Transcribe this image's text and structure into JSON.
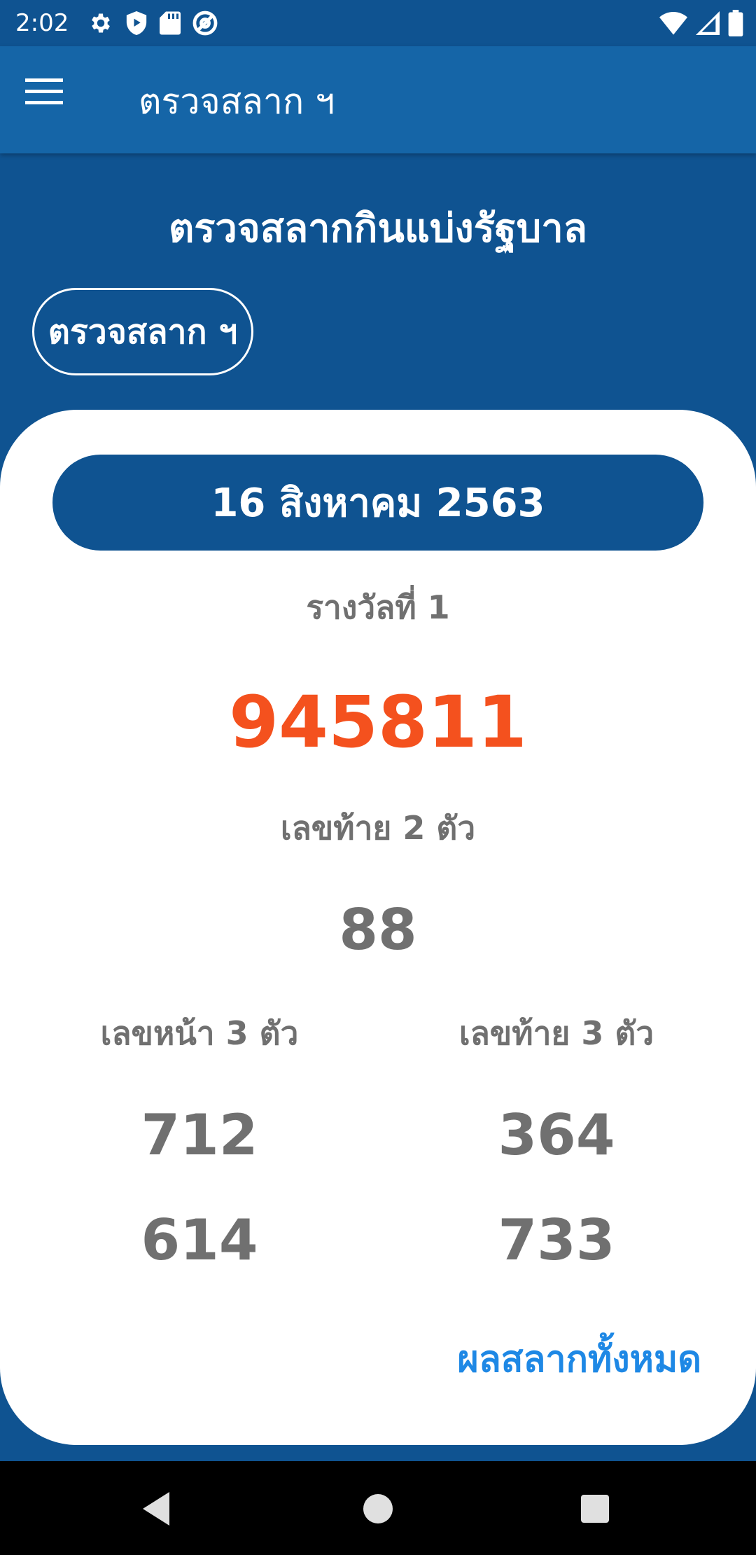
{
  "status_bar": {
    "time": "2:02",
    "left_icons": [
      "gear-icon",
      "shield-play-icon",
      "sd-card-icon",
      "at-sign-icon"
    ],
    "right_icons": [
      "wifi-icon",
      "signal-icon",
      "battery-icon"
    ]
  },
  "app_bar": {
    "title": "ตรวจสลาก ฯ",
    "menu_icon": "hamburger-menu-icon"
  },
  "page": {
    "title": "ตรวจสลากกินแบ่งรัฐบาล",
    "check_button_label": "ตรวจสลาก ฯ"
  },
  "results": {
    "draw_date": "16 สิงหาคม 2563",
    "first_prize_label": "รางวัลที่ 1",
    "first_prize_number": "945811",
    "last_two_label": "เลขท้าย 2 ตัว",
    "last_two_number": "88",
    "front_three_label": "เลขหน้า 3 ตัว",
    "front_three_numbers": [
      "712",
      "614"
    ],
    "last_three_label": "เลขท้าย 3 ตัว",
    "last_three_numbers": [
      "364",
      "733"
    ],
    "all_results_link": "ผลสลากทั้งหมด"
  },
  "nav_bar": {
    "icons": [
      "back-triangle-icon",
      "home-circle-icon",
      "recents-square-icon"
    ]
  },
  "colors": {
    "primary_dark": "#0f5391",
    "app_bar": "#1565a7",
    "prize_orange": "#f4511e",
    "link_blue": "#1e88e5",
    "text_gray": "#707070"
  }
}
